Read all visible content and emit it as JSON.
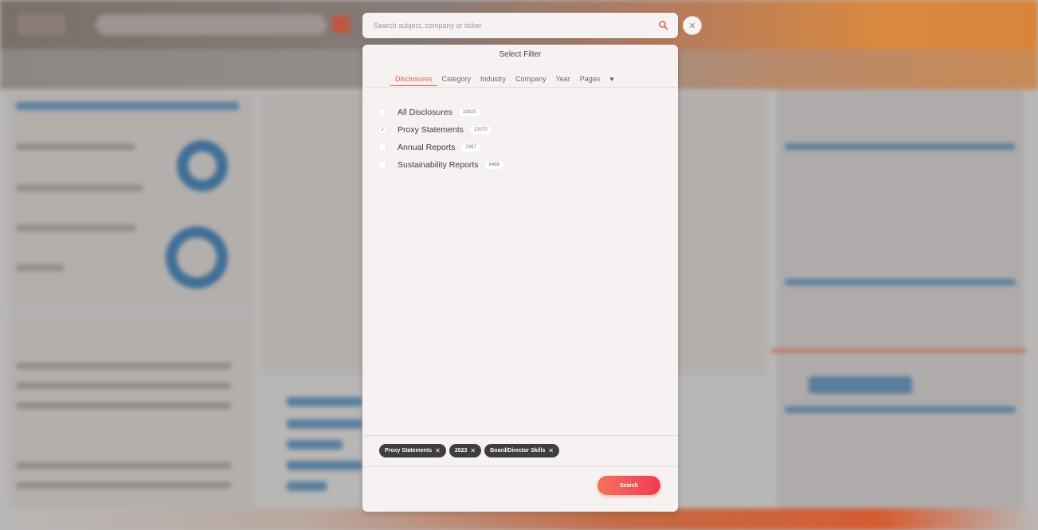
{
  "search": {
    "placeholder": "Search subject, company or ticker"
  },
  "close_icon": "✕",
  "modal": {
    "title": "Select Filter",
    "tabs": [
      {
        "label": "Disclosures",
        "active": true
      },
      {
        "label": "Category",
        "active": false
      },
      {
        "label": "Industry",
        "active": false
      },
      {
        "label": "Company",
        "active": false
      },
      {
        "label": "Year",
        "active": false
      },
      {
        "label": "Pages",
        "active": false
      },
      {
        "label": "♥",
        "active": false
      }
    ],
    "filters": [
      {
        "label": "All Disclosures",
        "count": "33925",
        "checked": false
      },
      {
        "label": "Proxy Statements",
        "count": "23070",
        "checked": true
      },
      {
        "label": "Annual Reports",
        "count": "2367",
        "checked": false
      },
      {
        "label": "Sustainability Reports",
        "count": "8488",
        "checked": false
      }
    ],
    "chips": [
      {
        "label": "Proxy Statements",
        "remove": "✕"
      },
      {
        "label": "2023",
        "remove": "✕"
      },
      {
        "label": "Board/Director Skills",
        "remove": "✕"
      }
    ],
    "search_button": "Search"
  },
  "colors": {
    "accent": "#e9584b",
    "button_gradient_start": "#f4735a",
    "button_gradient_end": "#ef3c54",
    "chip_bg": "#3f3d3d",
    "modal_bg": "#f6f2f1"
  }
}
